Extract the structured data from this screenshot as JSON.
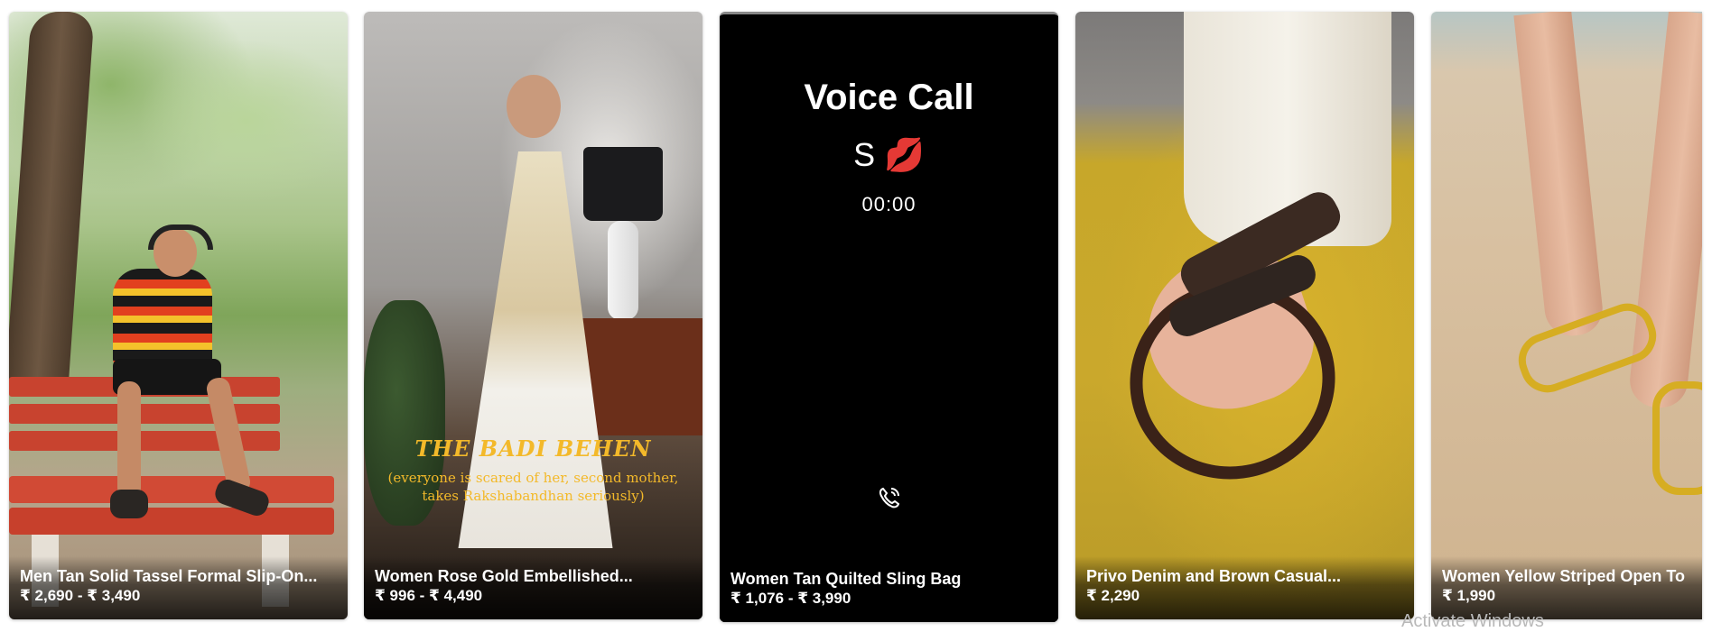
{
  "products": [
    {
      "title": "Men Tan Solid Tassel Formal Slip-On...",
      "price": "₹ 2,690 - ₹ 3,490"
    },
    {
      "title": "Women Rose Gold Embellished...",
      "price": "₹ 996 - ₹ 4,490",
      "overlay": {
        "headline": "THE BADI BEHEN",
        "subtitle": "(everyone is scared of her, second mother, takes Rakshabandhan seriously)"
      }
    },
    {
      "title": "Women Tan Quilted Sling Bag",
      "price": "₹ 1,076 - ₹ 3,990",
      "call": {
        "title": "Voice Call",
        "name": "S 💋",
        "timer": "00:00",
        "icon": "phone-call-icon"
      }
    },
    {
      "title": "Privo Denim and Brown Casual...",
      "price": "₹ 2,290"
    },
    {
      "title": "Women Yellow Striped Open To",
      "price": "₹ 1,990"
    }
  ],
  "system": {
    "watermark": "Activate Windows"
  },
  "colors": {
    "caption_text": "#ffffff",
    "overlay_accent": "#f3b92a",
    "call_background": "#000000"
  }
}
